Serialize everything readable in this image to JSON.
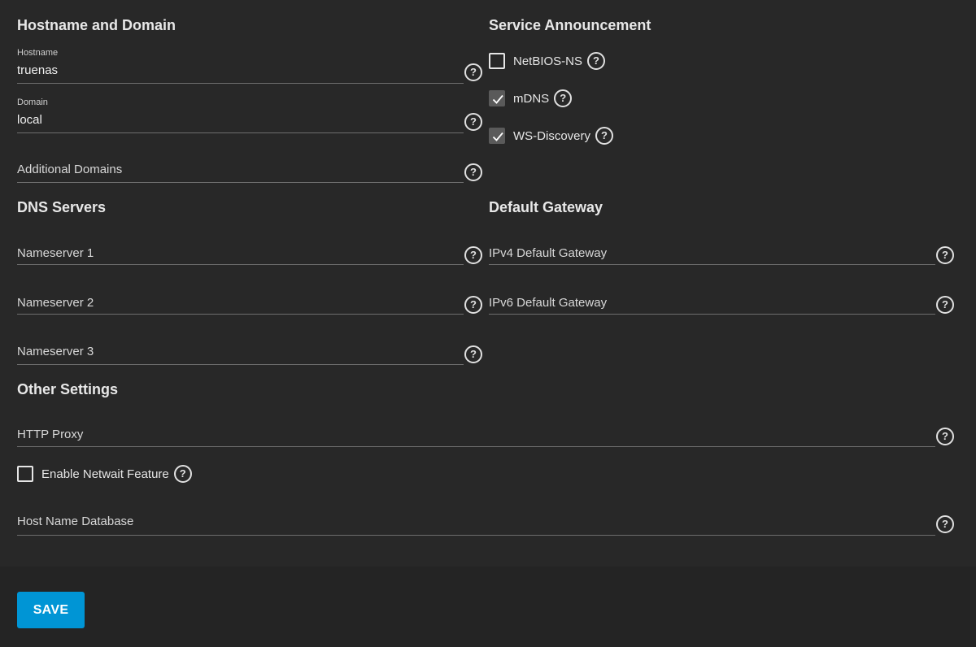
{
  "sections": {
    "hostname_domain": "Hostname and Domain",
    "service_announcement": "Service Announcement",
    "dns_servers": "DNS Servers",
    "default_gateway": "Default Gateway",
    "other_settings": "Other Settings"
  },
  "hostname": {
    "label": "Hostname",
    "value": "truenas"
  },
  "domain": {
    "label": "Domain",
    "value": "local"
  },
  "additional_domains": {
    "placeholder": "Additional Domains"
  },
  "service": {
    "netbios": {
      "label": "NetBIOS-NS",
      "checked": false
    },
    "mdns": {
      "label": "mDNS",
      "checked": true
    },
    "wsd": {
      "label": "WS-Discovery",
      "checked": true
    }
  },
  "dns": {
    "ns1": "Nameserver 1",
    "ns2": "Nameserver 2",
    "ns3": "Nameserver 3"
  },
  "gateway": {
    "ipv4": "IPv4 Default Gateway",
    "ipv6": "IPv6 Default Gateway"
  },
  "other": {
    "http_proxy": "HTTP Proxy",
    "netwait": {
      "label": "Enable Netwait Feature",
      "checked": false
    },
    "host_db": "Host Name Database"
  },
  "icons": {
    "help": "help-circle-icon",
    "check": "checkmark-icon"
  },
  "help_glyph": "?",
  "colors": {
    "accent": "#0095d5",
    "background": "#282828",
    "footer": "#242424"
  },
  "save_label": "SAVE"
}
